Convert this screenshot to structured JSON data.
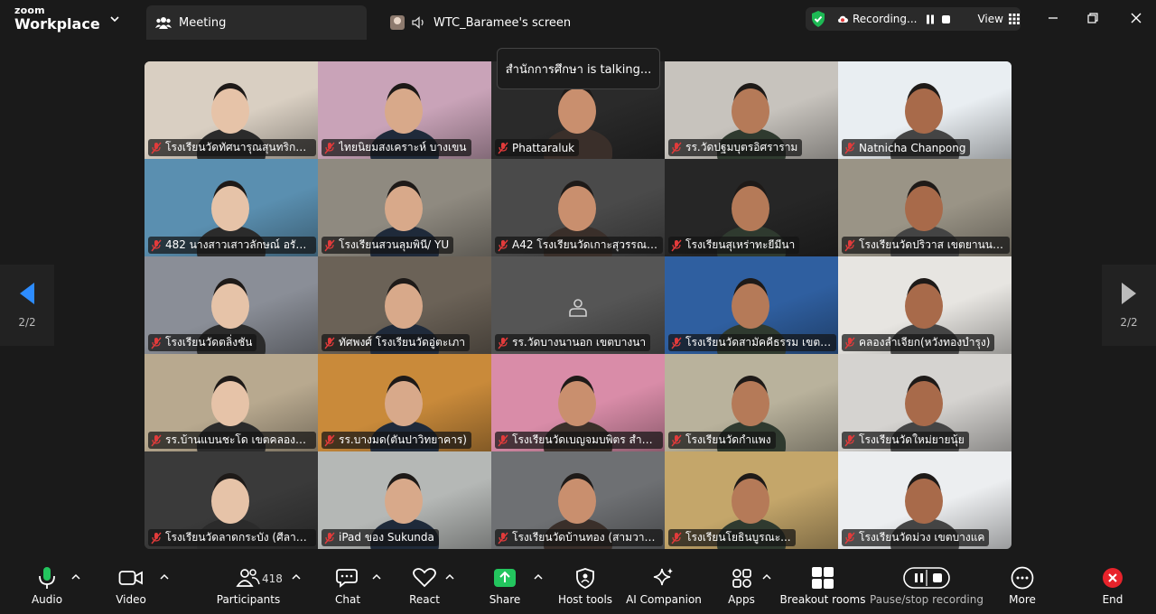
{
  "app": {
    "logo_line1": "zoom",
    "logo_line2": "Workplace"
  },
  "tabs": [
    {
      "label": "Meeting",
      "icon": "meeting-people-icon"
    },
    {
      "label": "WTC_Baramee's screen",
      "icon": "screen-share-icon"
    }
  ],
  "recording": {
    "label": "Recording...",
    "view_label": "View"
  },
  "talking_banner": "สำนักการศึกษา is talking...",
  "pager": {
    "left": "2/2",
    "right": "2/2"
  },
  "participants": [
    {
      "name": "โรงเรียนวัดทัศนารุณสุนทริการา...",
      "bg": "#d9cfc2"
    },
    {
      "name": "ไทยนิยมสงเคราะห์ บางเขน",
      "bg": "#c9a3b8"
    },
    {
      "name": "Phattaraluk",
      "bg": "#2a2a2a"
    },
    {
      "name": "รร.วัดปฐมบุตรอิศราราม",
      "bg": "#c7c3bd"
    },
    {
      "name": "Natnicha Chanpong",
      "bg": "#e9eef2"
    },
    {
      "name": "482 นางสาวเสาวลักษณ์ อรัญกิ...",
      "bg": "#5a8fb0"
    },
    {
      "name": "โรงเรียนสวนลุมพินี/ YU",
      "bg": "#8f8a80"
    },
    {
      "name": "A42 โรงเรียนวัดเกาะสุวรรณาราม",
      "bg": "#4a4a4a"
    },
    {
      "name": "โรงเรียนสุเหร่าทะยีมีนา",
      "bg": "#262626"
    },
    {
      "name": "โรงเรียนวัดปริวาส เขตยานนาวา",
      "bg": "#9a9486"
    },
    {
      "name": "โรงเรียนวัดตลิ่งชัน",
      "bg": "#8a8e97"
    },
    {
      "name": "ทัศพงศ์ โรงเรียนวัดอู่ตะเภา",
      "bg": "#6b6257"
    },
    {
      "name": "รร.วัดบางนานอก เขตบางนา",
      "bg": "#555555"
    },
    {
      "name": "โรงเรียนวัดสามัคคีธรรม เขตวังท...",
      "bg": "#2f5fa0"
    },
    {
      "name": "คลองลำเจียก(หวังทองบำรุง)",
      "bg": "#e7e5e1"
    },
    {
      "name": "รร.บ้านแบนชะโด เขตคลองสามวา",
      "bg": "#b8a98f"
    },
    {
      "name": "รร.บางมด(ตันปาวิทยาคาร)",
      "bg": "#c98a3a"
    },
    {
      "name": "โรงเรียนวัดเบญจมบพิตร สำนักง...",
      "bg": "#d98ca8"
    },
    {
      "name": "โรงเรียนวัดกำแพง",
      "bg": "#b9b29c"
    },
    {
      "name": "โรงเรียนวัดใหม่ยายนุ้ย",
      "bg": "#d5d3d0"
    },
    {
      "name": "โรงเรียนวัดลาดกระบัง (ศีลาภิรัตอ...",
      "bg": "#3a3a3a"
    },
    {
      "name": "iPad ของ Sukunda",
      "bg": "#b5b8b6"
    },
    {
      "name": "โรงเรียนวัดบ้านทอง (สามวาวิทยา)",
      "bg": "#6e7073"
    },
    {
      "name": "โรงเรียนโยธินบูรณะ...",
      "bg": "#c4a66a"
    },
    {
      "name": "โรงเรียนวัดม่วง เขตบางแค",
      "bg": "#eceef0"
    }
  ],
  "toolbar": {
    "audio": "Audio",
    "video": "Video",
    "participants": "Participants",
    "participants_count": "418",
    "chat": "Chat",
    "react": "React",
    "share": "Share",
    "host_tools": "Host tools",
    "ai_companion": "AI Companion",
    "apps": "Apps",
    "breakout": "Breakout rooms",
    "pause_stop": "Pause/stop recording",
    "more": "More",
    "end": "End"
  },
  "colors": {
    "share_green": "#23c55e",
    "end_red": "#e8232b",
    "mute_red": "#e23b3b",
    "shield_green": "#1db954"
  }
}
